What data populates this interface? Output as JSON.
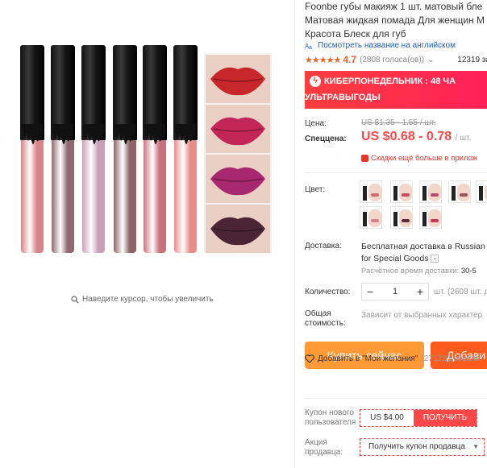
{
  "product": {
    "title_lines": [
      "Foonbe губы макияж 1 шт. матовый бле",
      "Матовая жидкая помада Для женщин М",
      "Красота Блеск для губ"
    ],
    "translate_link": "Посмотреть название на английском",
    "rating": "4.7",
    "votes": "(2808 голоса(ов))",
    "orders": "12319 за"
  },
  "gallery": {
    "zoom_hint": "Наведите курсор, чтобы увеличить",
    "tube_colors": [
      "#d98488",
      "#8e6a72",
      "#c9a0b8",
      "#8d6468",
      "#c9727e",
      "#e98d8a"
    ],
    "lip_colors": [
      "#c7262a",
      "#c22658",
      "#a8286f",
      "#4b2435"
    ]
  },
  "promo": {
    "line1": "КИБЕРПОНЕДЕЛЬНИК : 48 ЧА",
    "line2": "УЛЬТРАВЫГОДЫ"
  },
  "price": {
    "price_label": "Цена:",
    "old_price": "US $1.35 - 1.55 / шт.",
    "special_label": "Спеццена:",
    "new_price": "US $0.68 - 0.78",
    "unit": "/ шт.",
    "discount_note": "Скидки ещё больше в прилож"
  },
  "color": {
    "label": "Цвет:",
    "swatch_colors": [
      "#d0706e",
      "#c74a5e",
      "#b84a6e",
      "#9c5060",
      "#7a3a44",
      "#d2848c",
      "#5b2d3a",
      "#c13b58"
    ]
  },
  "shipping": {
    "label": "Доставка:",
    "main": "Бесплатная доставка в Russian",
    "sub": "for Special Goods",
    "time_label": "Расчётное время доставки:",
    "time_value": "30-5"
  },
  "quantity": {
    "label": "Количество:",
    "minus": "−",
    "value": "1",
    "plus": "+",
    "stock": "шт. (2608 шт. д"
  },
  "total": {
    "label_line1": "Общая",
    "label_line2": "стоимость:",
    "value": "Зависит от выбранных характер"
  },
  "actions": {
    "buy_now": "Купить сейчас",
    "add_to_cart": "Добави",
    "wishlist": "Добавить в \"Мои желания\"",
    "wishlist_count": "(27122 добавле"
  },
  "coupons": {
    "new_user_label_1": "Купон нового",
    "new_user_label_2": "пользователя",
    "new_user_amount": "US $4.00",
    "new_user_button": "ПОЛУЧИТЬ",
    "seller_label_1": "Акция",
    "seller_label_2": "продавца:",
    "seller_button": "Получить купон продавца"
  },
  "colors": {
    "accent_red": "#ff4747",
    "buy_orange": "#ff9a36",
    "cart_orange": "#ff5b1f",
    "rating_orange": "#e7662b",
    "link_blue": "#1e5ebd"
  }
}
